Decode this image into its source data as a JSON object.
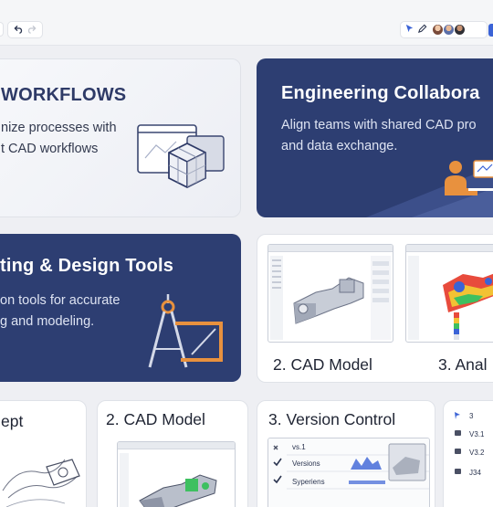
{
  "toolbar": {
    "undo_icon": "undo-icon",
    "redo_icon": "redo-icon",
    "cursor_icon": "cursor-icon",
    "pen_icon": "pen-icon",
    "avatars": [
      "avatar-1",
      "avatar-2",
      "avatar-3"
    ]
  },
  "cards": {
    "workflows": {
      "title": "WORKFLOWS",
      "line1": "nize processes with",
      "line2": "t CAD workflows"
    },
    "collaboration": {
      "title": "Engineering Collabora",
      "line1": "Align teams with shared CAD pro",
      "line2": "and data exchange."
    },
    "design_tools": {
      "title": "ting & Design Tools",
      "line1": "on tools for accurate",
      "line2": "g and modeling."
    },
    "cad_analysis": {
      "label_cad": "2. CAD Model",
      "label_analysis": "3. Anal"
    },
    "concept": {
      "label": "ept"
    },
    "cad_model": {
      "label": "2. CAD Model"
    },
    "version_control": {
      "label": "3. Version Control",
      "rows": [
        "vs.1",
        "Versions",
        "Syperiens"
      ]
    },
    "versions_list": {
      "rows": [
        "3",
        "V3.1",
        "V3.2",
        "J34"
      ]
    }
  },
  "colors": {
    "navy": "#2d3e72",
    "accent_orange": "#e8913e",
    "accent_blue": "#3b63d6",
    "background": "#eeeff3"
  }
}
